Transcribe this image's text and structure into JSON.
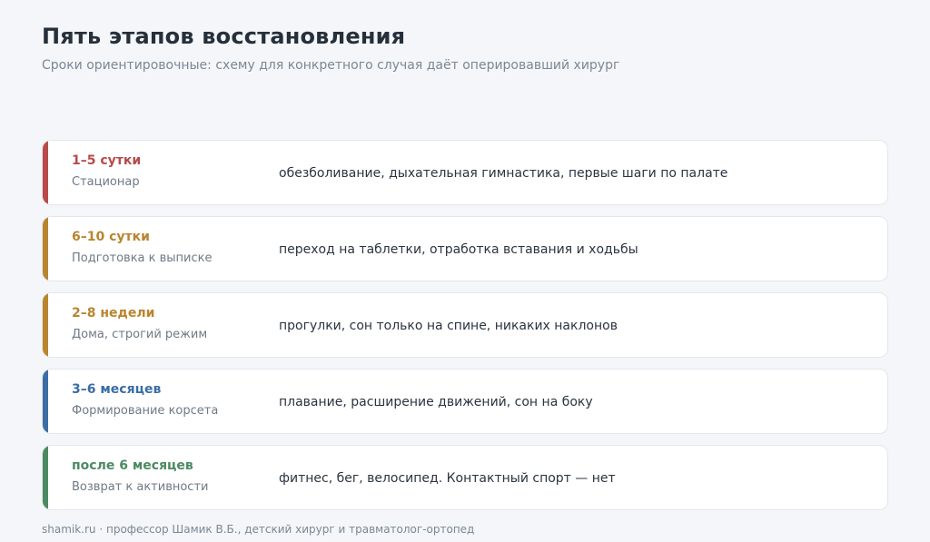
{
  "title": "Пять этапов восстановления",
  "subtitle": "Сроки ориентировочные: схему для конкретного случая даёт оперировавший хирург",
  "stages": [
    {
      "period": "1–5 сутки",
      "label": "Стационар",
      "description": "обезболивание, дыхательная гимнастика, первые шаги по палате",
      "color": "#b84a4a"
    },
    {
      "period": "6–10 сутки",
      "label": "Подготовка к выписке",
      "description": "переход на таблетки, отработка вставания и ходьбы",
      "color": "#b9852f"
    },
    {
      "period": "2–8 недели",
      "label": "Дома, строгий режим",
      "description": "прогулки, сон только на спине, никаких наклонов",
      "color": "#b9852f"
    },
    {
      "period": "3–6 месяцев",
      "label": "Формирование корсета",
      "description": "плавание, расширение движений, сон на боку",
      "color": "#3a6ea5"
    },
    {
      "period": "после 6 месяцев",
      "label": "Возврат к активности",
      "description": "фитнес, бег, велосипед. Контактный спорт — нет",
      "color": "#4c8a63"
    }
  ],
  "footer": "shamik.ru · профессор Шамик В.Б., детский хирург и травматолог-ортопед"
}
